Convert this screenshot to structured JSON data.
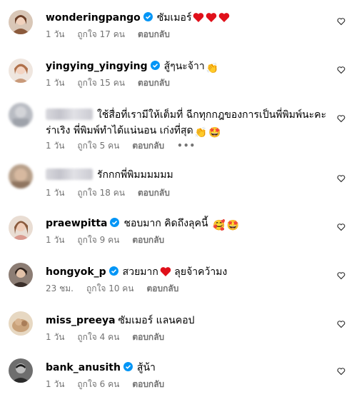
{
  "comments": [
    {
      "username": "wonderingpango",
      "verified": true,
      "text": "ซัมเมอร์",
      "emojis": [
        "red-heart",
        "red-heart",
        "red-heart"
      ],
      "time": "1 วัน",
      "likes": "ถูกใจ 17 คน",
      "reply": "ตอบกลับ"
    },
    {
      "username": "yingying_yingying",
      "verified": true,
      "text": "สู้ๆนะจ้าา",
      "emojis": [
        "clapping-hands"
      ],
      "time": "1 วัน",
      "likes": "ถูกใจ 15 คน",
      "reply": "ตอบกลับ"
    },
    {
      "username": "",
      "verified": false,
      "text": "ใช้สื่อที่เรามีให้เต็มที่ ฉีกทุกกฎของการเป็นพี่พิมพ์นะคะ",
      "text2": "ร่าเริง พี่พิมพ์ทำได้แน่นอน เก่งที่สุด",
      "emojis": [
        "clapping-hands",
        "star-struck-face"
      ],
      "time": "1 วัน",
      "likes": "ถูกใจ 5 คน",
      "reply": "ตอบกลับ",
      "more": "•••"
    },
    {
      "username": "",
      "verified": false,
      "text": "รักกกพี่พิมมมมมม",
      "emojis": [],
      "time": "1 วัน",
      "likes": "ถูกใจ 18 คน",
      "reply": "ตอบกลับ"
    },
    {
      "username": "praewpitta",
      "verified": true,
      "text": "ชอบมาก คิดถึงลุคนี้",
      "emojis": [
        "smiling-hearts-face",
        "star-struck-face"
      ],
      "time": "1 วัน",
      "likes": "ถูกใจ 9 คน",
      "reply": "ตอบกลับ"
    },
    {
      "username": "hongyok_p",
      "verified": true,
      "text": "สวยมาก",
      "text_after": "ลุยจ้าคว้ามง",
      "emojis": [
        "red-heart"
      ],
      "time": "23 ชม.",
      "likes": "ถูกใจ 10 คน",
      "reply": "ตอบกลับ"
    },
    {
      "username": "miss_preeya",
      "verified": false,
      "text": "ซัมเมอร์ แลนคอป",
      "emojis": [],
      "time": "1 วัน",
      "likes": "ถูกใจ 4 คน",
      "reply": "ตอบกลับ"
    },
    {
      "username": "bank_anusith",
      "verified": true,
      "text": "สู้น้า",
      "emojis": [],
      "time": "1 วัน",
      "likes": "ถูกใจ 6 คน",
      "reply": "ตอบกลับ"
    }
  ],
  "colors": {
    "verified": "#0095f6",
    "meta": "#737373",
    "heart": "#ed4956"
  }
}
